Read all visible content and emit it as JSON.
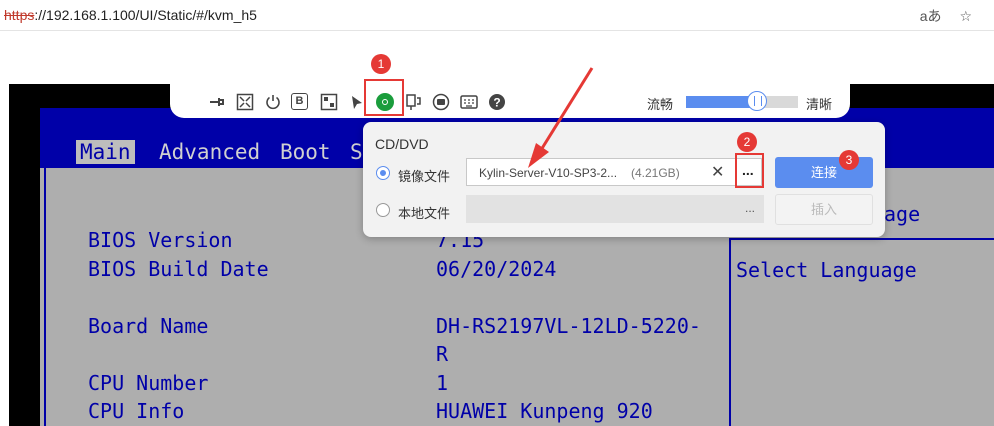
{
  "browser": {
    "url_scheme": "https",
    "url_rest": "://192.168.1.100/UI/Static/#/kvm_h5",
    "reader_icon": "aあ",
    "favorite_icon": "☆"
  },
  "toolbar": {
    "icons": [
      "pin-icon",
      "fullscreen-icon",
      "power-icon",
      "boot-icon",
      "keyboard-layout-icon",
      "mouse-icon",
      "cd-dvd-icon",
      "usb-icon",
      "record-icon",
      "virtual-keyboard-icon",
      "help-icon"
    ],
    "boot_letter": "B",
    "quality_low": "流畅",
    "quality_high": "清晰",
    "quality_level": 0.63
  },
  "media_panel": {
    "title": "CD/DVD",
    "image_option_label": "镜像文件",
    "local_option_label": "本地文件",
    "image_file_name": "Kylin-Server-V10-SP3-2...",
    "image_file_size": "(4.21GB)",
    "clear_symbol": "✕",
    "browse_symbol": "...",
    "local_browse_symbol": "...",
    "connect_label": "连接",
    "insert_label": "插入",
    "selected_option": "image"
  },
  "annotations": {
    "step1": "1",
    "step2": "2",
    "step3": "3",
    "color": "#e53935"
  },
  "bios": {
    "tabs": [
      "Main",
      "Advanced",
      "Boot",
      "S"
    ],
    "bios_version_label": "BIOS Version",
    "bios_version_value": "7.15",
    "bios_build_date_label": "BIOS Build Date",
    "bios_build_date_value": "06/20/2024",
    "board_name_label": "Board Name",
    "board_name_value_1": "DH-RS2197VL-12LD-5220-",
    "board_name_value_2": "R",
    "cpu_number_label": "CPU Number",
    "cpu_number_value": "1",
    "cpu_info_label": "CPU Info",
    "cpu_info_value": "HUAWEI Kunpeng 920",
    "help_heading": "age",
    "help_item": "Select Language"
  },
  "colors": {
    "bios_blue": "#0000a8",
    "bios_gray": "#aeaeae",
    "accent": "#5b8def",
    "cd_green": "#1a9d3c"
  }
}
